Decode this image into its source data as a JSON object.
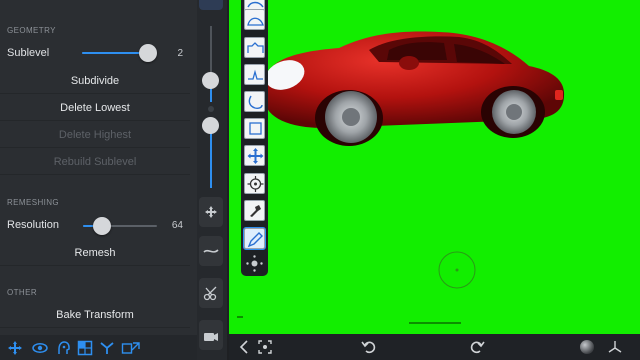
{
  "geometry": {
    "header": "GEOMETRY",
    "sublevel": {
      "label": "Sublevel",
      "value": "2",
      "fraction": 1.0
    },
    "subdivide": "Subdivide",
    "delete_lowest": "Delete Lowest",
    "delete_highest": "Delete Highest",
    "rebuild_sublevel": "Rebuild Sublevel"
  },
  "remeshing": {
    "header": "REMESHING",
    "resolution": {
      "label": "Resolution",
      "value": "64",
      "fraction": 0.25
    },
    "remesh": "Remesh"
  },
  "other": {
    "header": "OTHER",
    "bake_transform": "Bake Transform"
  },
  "left_bottom_icons": [
    "move-icon",
    "eye-icon",
    "head-icon",
    "grid-icon",
    "topology-icon",
    "transform-icon"
  ],
  "vertical_strip": {
    "radius_level": 0.58,
    "strength_level": 0.82,
    "icons": [
      "move-arrows-icon",
      "stroke-curve-icon",
      "scissors-icon",
      "video-camera-icon"
    ]
  },
  "tools": [
    "clay-brush-icon",
    "inflate-brush-icon",
    "layer-brush-icon",
    "pinch-brush-icon",
    "flatten-brush-icon",
    "move-brush-icon",
    "transform-brush-icon",
    "drag-brush-icon",
    "paint-brush-icon",
    "more-tools-icon"
  ],
  "viewport": {
    "background": "#12ee00",
    "car_color": "#b3120f"
  },
  "bottom_right_icons": [
    "back-icon",
    "frame-icon",
    "undo-icon",
    "redo-icon",
    "material-sphere-icon",
    "axis-icon"
  ],
  "colors": {
    "accent": "#2e8ff0",
    "panel": "#2b2e32"
  }
}
